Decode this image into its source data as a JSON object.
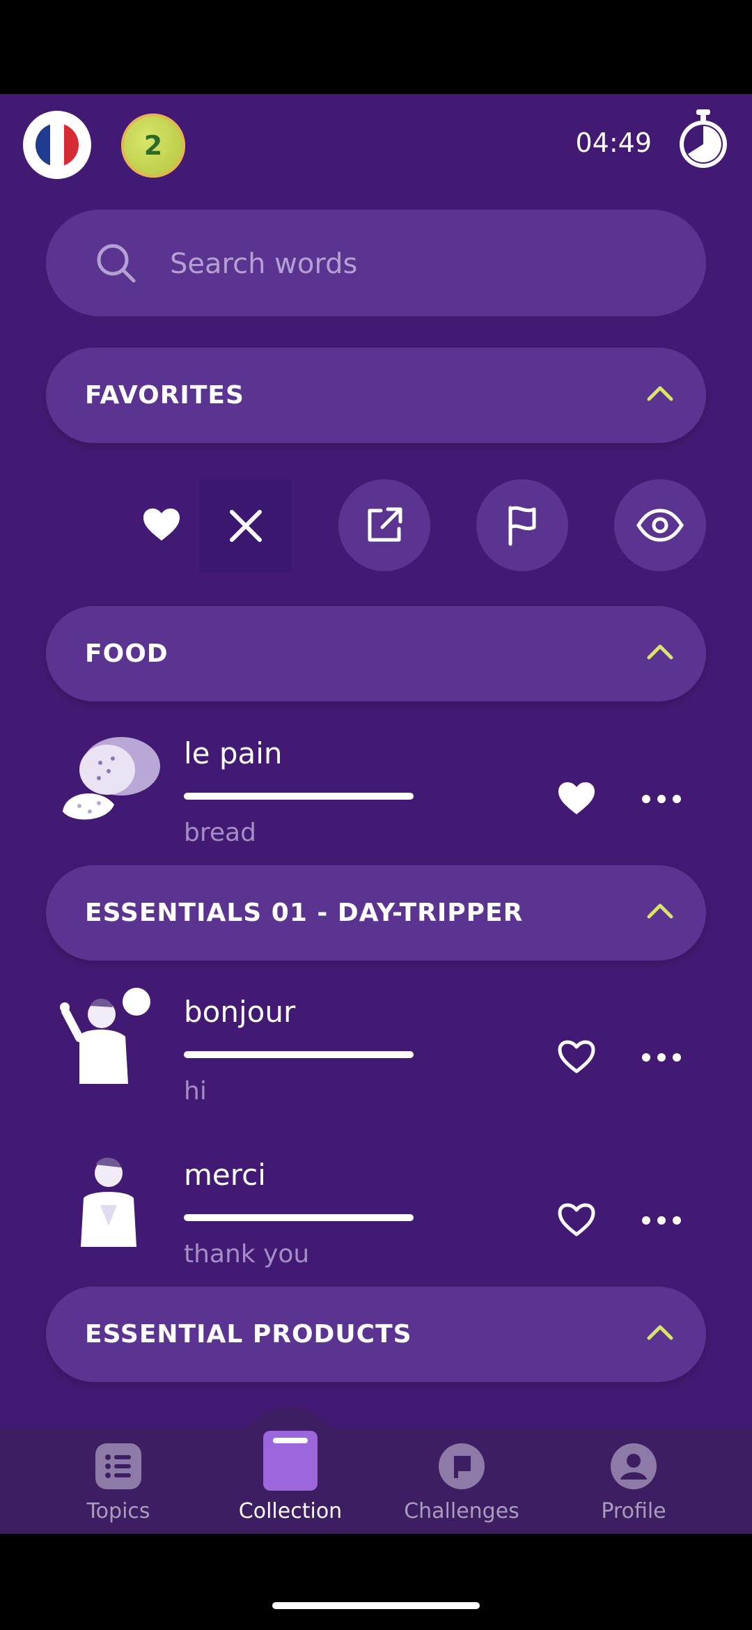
{
  "header": {
    "level": "2",
    "timer": "04:49"
  },
  "search": {
    "placeholder": "Search words"
  },
  "sections": {
    "favorites": "FAVORITES",
    "food": "FOOD",
    "essentials": "ESSENTIALS 01 - DAY-TRIPPER",
    "products": "ESSENTIAL PRODUCTS"
  },
  "words": [
    {
      "word": "le pain",
      "translation": "bread",
      "favorite": true
    },
    {
      "word": "bonjour",
      "translation": "hi",
      "favorite": false
    },
    {
      "word": "merci",
      "translation": "thank you",
      "favorite": false
    }
  ],
  "nav": {
    "items": [
      {
        "label": "Topics"
      },
      {
        "label": "Collection"
      },
      {
        "label": "Challenges"
      },
      {
        "label": "Profile"
      }
    ],
    "active": "Collection"
  },
  "colors": {
    "background": "#431a73",
    "card": "#5a3490",
    "accent": "#d8e56a",
    "navbar": "#3e1e62"
  }
}
